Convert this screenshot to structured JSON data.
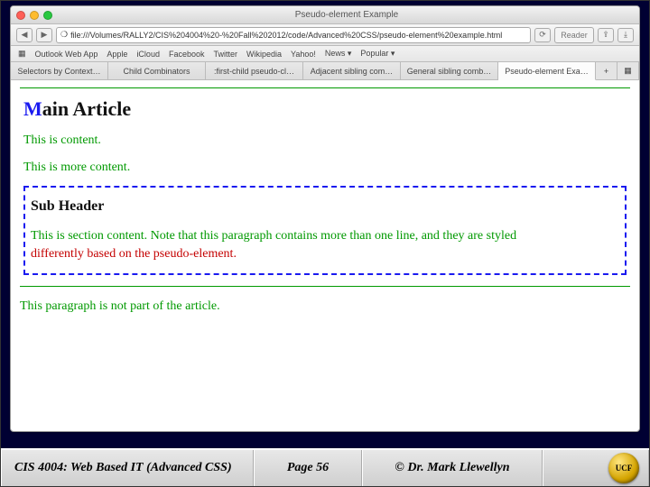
{
  "window": {
    "title": "Pseudo-element Example"
  },
  "url": "file:///Volumes/RALLY2/CIS%204004%20-%20Fall%202012/code/Advanced%20CSS/pseudo-element%20example.html",
  "reader_label": "Reader",
  "bookmarks": [
    "Outlook Web App",
    "Apple",
    "iCloud",
    "Facebook",
    "Twitter",
    "Wikipedia",
    "Yahoo!",
    "News ▾",
    "Popular ▾"
  ],
  "tabs": {
    "items": [
      "Selectors by Context…",
      "Child Combinators",
      ":first-child pseudo-cl…",
      "Adjacent sibling com…",
      "General sibling comb…",
      "Pseudo-element Exa…"
    ],
    "active_index": 5
  },
  "page": {
    "h1_first_letter": "M",
    "h1_rest": "ain Article",
    "p1": "This is content.",
    "p2": "This is more content.",
    "sub_header": "Sub Header",
    "section_line1": "This is section content. Note that this paragraph contains more than one line, and they are styled",
    "section_line2": "differently based on the pseudo-element.",
    "outside": "This paragraph is not part of the article."
  },
  "footer": {
    "course": "CIS 4004: Web Based IT (Advanced CSS)",
    "page": "Page 56",
    "author": "© Dr. Mark Llewellyn",
    "logo_text": "UCF"
  }
}
